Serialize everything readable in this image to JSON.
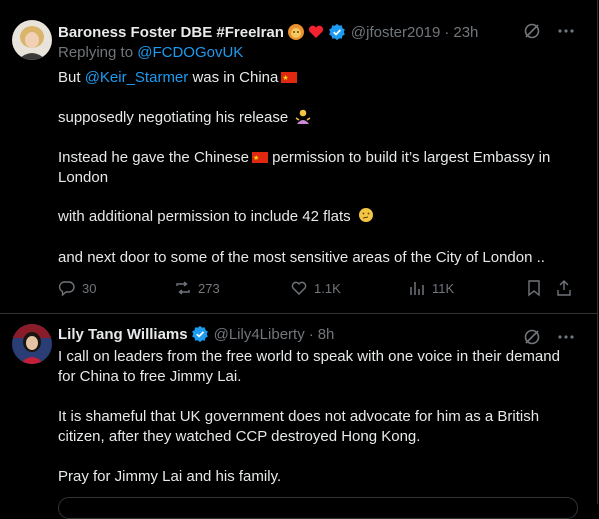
{
  "tweet1": {
    "name": "Baroness Foster DBE #FreeIran",
    "handle": "@jfoster2019",
    "time": "23h",
    "replying_prefix": "Replying to",
    "replying_handle": "@FCDOGovUK",
    "line1_pre": "But",
    "line1_mention": "@Keir_Starmer",
    "line1_post": "was in China",
    "line2": "supposedly negotiating his release",
    "line3a_pre": "Instead he gave the Chinese",
    "line3a_post": "permission to build it’s largest Embassy in",
    "line3b": "London",
    "line4": "with additional permission to include 42 flats",
    "line5": "and next door to some of the most sensitive areas of the City of London ..",
    "replies": "30",
    "reposts": "273",
    "likes": "1.1K",
    "views": "11K"
  },
  "tweet2": {
    "name": "Lily Tang Williams",
    "handle": "@Lily4Liberty",
    "time": "8h",
    "line1": "I call on leaders from the free world to speak with one voice in their demand",
    "line2": "for China to free Jimmy Lai.",
    "line3": "It is shameful that UK government does not advocate for him as a British",
    "line4": "citizen, after they watched CCP destroyed Hong Kong.",
    "line5": "Pray for Jimmy Lai and his family."
  },
  "sep": "·",
  "colors": {
    "accent": "#1d9bf0",
    "muted": "#71767b",
    "text": "#e7e9ea",
    "bg": "#000000",
    "border": "#2f3336"
  }
}
